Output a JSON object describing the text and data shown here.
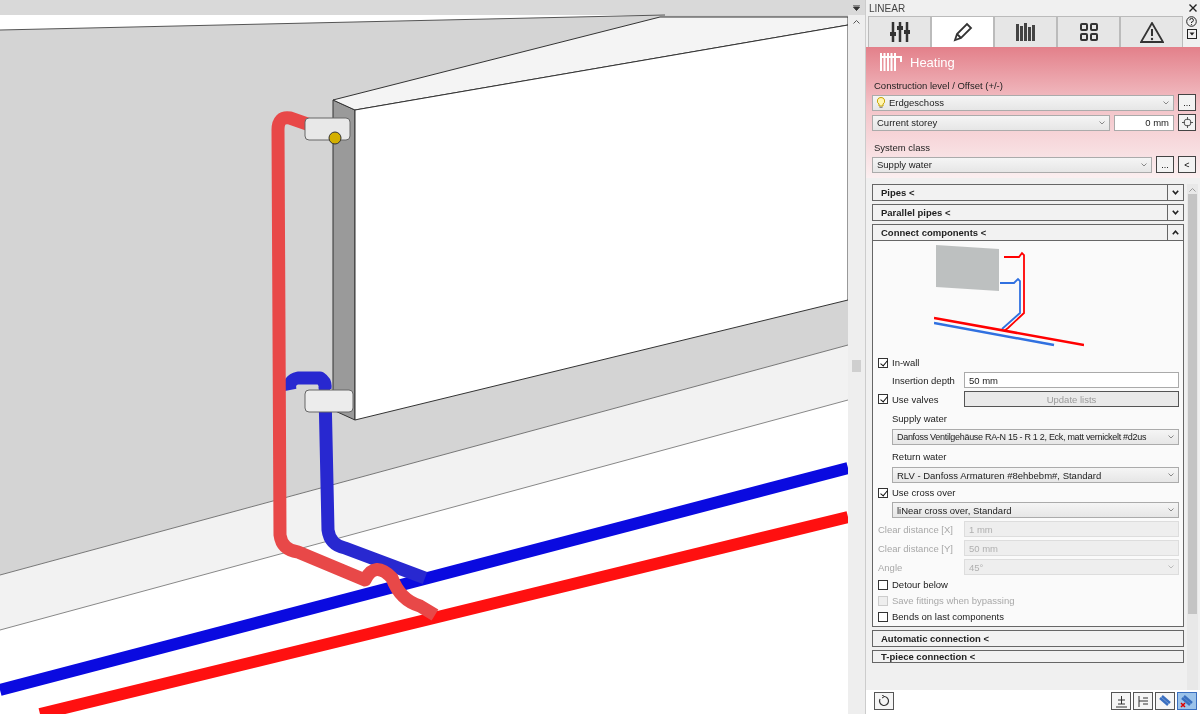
{
  "panel": {
    "title": "LINEAR",
    "tabs": [
      {
        "selected": false
      },
      {
        "selected": true
      },
      {
        "selected": false
      },
      {
        "selected": false
      },
      {
        "selected": false
      }
    ],
    "header": {
      "title": "Heating",
      "construction_label": "Construction level / Offset (+/-)",
      "level_select": "Erdgeschoss",
      "level_button": "...",
      "reference_select": "Current storey",
      "offset": "0 mm",
      "system_class_label": "System class",
      "system_class_select": "Supply water",
      "system_buttons": [
        "...",
        "<"
      ]
    },
    "sections": [
      {
        "title": "Pipes <",
        "expanded": false
      },
      {
        "title": "Parallel pipes <",
        "expanded": false
      },
      {
        "title": "Connect components <",
        "expanded": true
      }
    ],
    "connect": {
      "in_wall": {
        "label": "In-wall",
        "checked": true
      },
      "insertion_depth": {
        "label": "Insertion depth",
        "value": "50 mm"
      },
      "use_valves": {
        "label": "Use valves",
        "checked": true
      },
      "update_button": {
        "label": "Update lists",
        "disabled": true
      },
      "supply_label": "Supply water",
      "supply_select": "Danfoss Ventilgehäuse RA-N 15 - R 1 2, Eck, matt vernickelt #d2us",
      "return_label": "Return water",
      "return_select": "RLV - Danfoss Armaturen #8ehbebm#, Standard",
      "use_cross_over": {
        "label": "Use cross over",
        "checked": true
      },
      "cross_over_select": "liNear cross over, Standard",
      "disabled_fields": [
        {
          "label": "Clear distance [X]",
          "value": "1 mm",
          "kind": "input",
          "disabled": true
        },
        {
          "label": "Clear distance [Y]",
          "value": "50 mm",
          "kind": "input",
          "disabled": true
        },
        {
          "label": "Angle",
          "value": "45°",
          "kind": "select",
          "disabled": true
        }
      ],
      "options": [
        {
          "label": "Detour below",
          "checked": false,
          "disabled": false
        },
        {
          "label": "Save fittings when bypassing",
          "checked": false,
          "disabled": true
        },
        {
          "label": "Bends on last components",
          "checked": false,
          "disabled": false
        }
      ]
    },
    "collapsed_sections": [
      {
        "title": "Automatic connection <"
      },
      {
        "title": "T-piece connection <"
      }
    ],
    "toolbar_buttons": [
      {
        "selected": false
      },
      {
        "selected": false
      },
      {
        "selected": false
      },
      {
        "selected": true
      }
    ]
  }
}
